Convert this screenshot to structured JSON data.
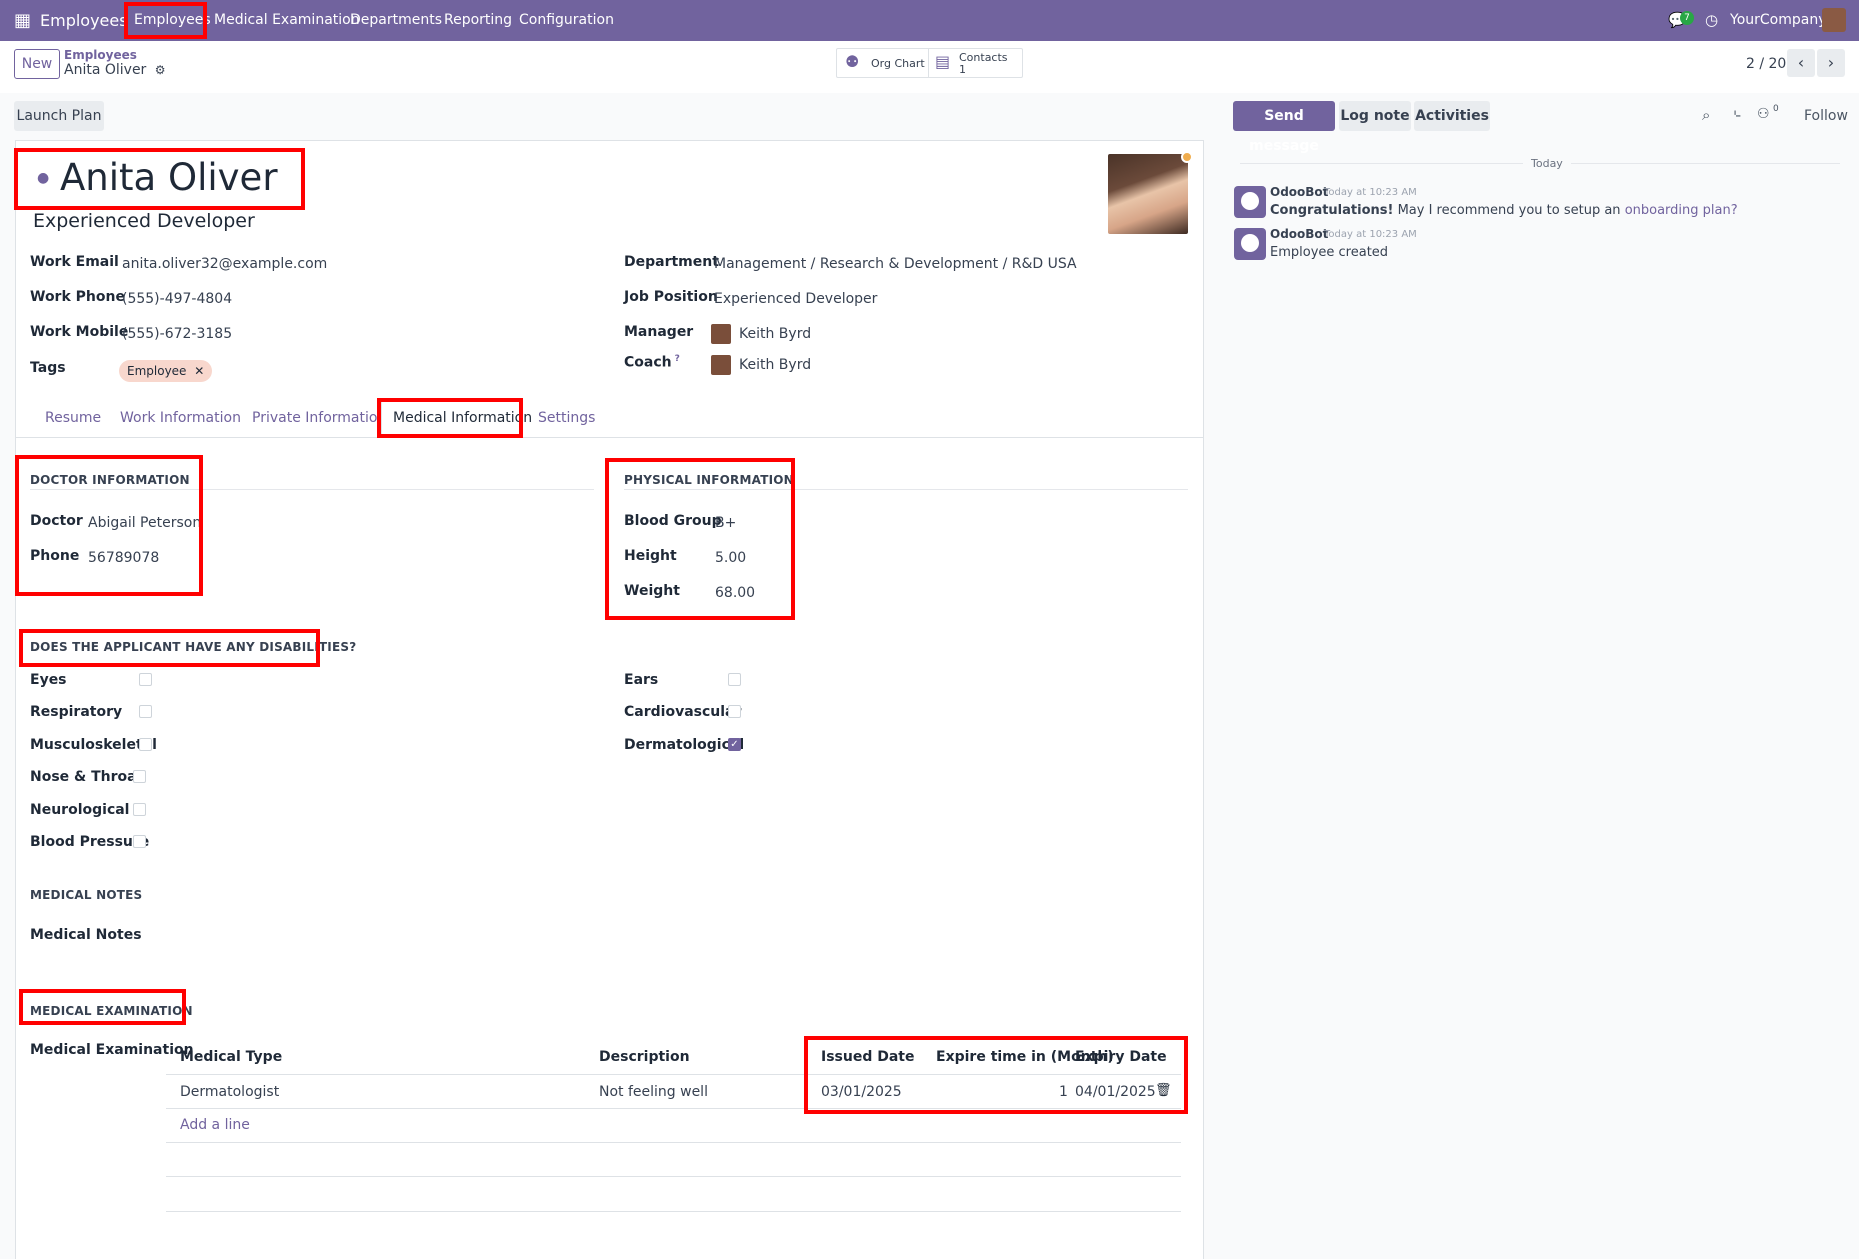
{
  "navbar": {
    "app_name": "Employees",
    "menu": [
      "Employees",
      "Medical Examination",
      "Departments",
      "Reporting",
      "Configuration"
    ],
    "message_count": "7",
    "company": "YourCompany"
  },
  "control": {
    "new_label": "New",
    "breadcrumb_parent": "Employees",
    "breadcrumb_current": "Anita Oliver",
    "org_chart_label": "Org Chart",
    "contacts_label": "Contacts",
    "contacts_count": "1",
    "pager": "2 / 20"
  },
  "actions": {
    "launch_plan": "Launch Plan",
    "send_message": "Send message",
    "log_note": "Log note",
    "activities": "Activities",
    "follow": "Follow",
    "followers_count": "0"
  },
  "employee": {
    "name": "Anita Oliver",
    "job_title": "Experienced Developer",
    "left_fields": [
      {
        "label": "Work Email",
        "value": "anita.oliver32@example.com"
      },
      {
        "label": "Work Phone",
        "value": "(555)-497-4804"
      },
      {
        "label": "Work Mobile",
        "value": "(555)-672-3185"
      }
    ],
    "tags_label": "Tags",
    "tag": "Employee",
    "department_label": "Department",
    "department": "Management / Research & Development / R&D USA",
    "job_position_label": "Job Position",
    "job_position": "Experienced Developer",
    "manager_label": "Manager",
    "manager": "Keith Byrd",
    "coach_label": "Coach",
    "coach": "Keith Byrd",
    "coach_help": "?"
  },
  "tabs": [
    "Resume",
    "Work Information",
    "Private Information",
    "Medical Information",
    "Settings"
  ],
  "medical": {
    "doctor_section": "DOCTOR INFORMATION",
    "doctor_label": "Doctor",
    "doctor": "Abigail Peterson",
    "phone_label": "Phone",
    "phone": "56789078",
    "physical_section": "PHYSICAL INFORMATION",
    "blood_group_label": "Blood Group",
    "blood_group": "B+",
    "height_label": "Height",
    "height": "5.00",
    "weight_label": "Weight",
    "weight": "68.00",
    "disabilities_section": "DOES THE APPLICANT HAVE ANY DISABILITIES?",
    "disabilities_left": [
      {
        "label": "Eyes",
        "checked": false
      },
      {
        "label": "Respiratory",
        "checked": false
      },
      {
        "label": "Musculoskeletal",
        "checked": false
      },
      {
        "label": "Nose & Throat",
        "checked": false
      },
      {
        "label": "Neurological",
        "checked": false
      },
      {
        "label": "Blood Pressure",
        "checked": false
      }
    ],
    "disabilities_right": [
      {
        "label": "Ears",
        "checked": false
      },
      {
        "label": "Cardiovascular",
        "checked": false
      },
      {
        "label": "Dermatological",
        "checked": true
      }
    ],
    "notes_section": "MEDICAL NOTES",
    "notes_label": "Medical Notes",
    "exam_section": "MEDICAL EXAMINATION",
    "exam_label": "Medical Examination",
    "exam_columns": [
      "Medical Type",
      "Description",
      "Issued Date",
      "Expire time in (Month)",
      "Expiry Date"
    ],
    "exam_rows": [
      {
        "type": "Dermatologist",
        "description": "Not feeling well",
        "issued": "03/01/2025",
        "expire_months": "1",
        "expiry": "04/01/2025"
      }
    ],
    "add_line": "Add a line"
  },
  "chatter": {
    "day": "Today",
    "messages": [
      {
        "author": "OdooBot",
        "time": "Today at 10:23 AM",
        "bold": "Congratulations!",
        "text": " May I recommend you to setup an ",
        "link": "onboarding plan?"
      },
      {
        "author": "OdooBot",
        "time": "Today at 10:23 AM",
        "text": "Employee created"
      }
    ]
  },
  "colors": {
    "brand": "#71639e",
    "highlight": "#ff0000",
    "badge": "#28a745",
    "status_dot": "#f0ad4e"
  }
}
